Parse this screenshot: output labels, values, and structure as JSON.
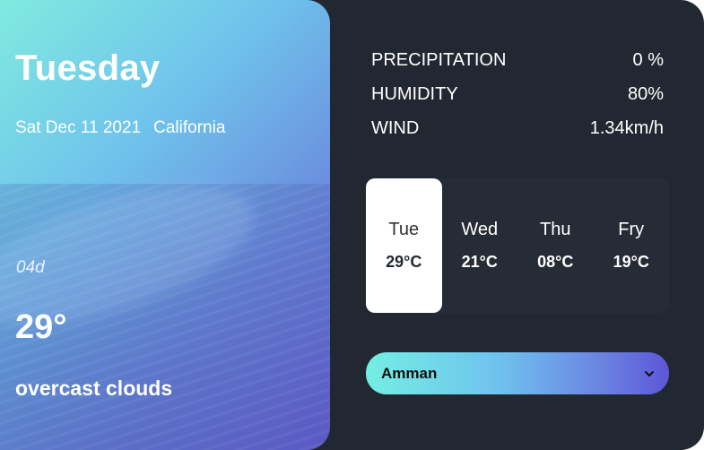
{
  "current": {
    "day": "Tuesday",
    "date": "Sat Dec 11 2021",
    "location": "California",
    "icon_code": "04d",
    "temperature": "29°",
    "description": "overcast clouds"
  },
  "stats": [
    {
      "label": "PRECIPITATION",
      "value": "0 %"
    },
    {
      "label": "HUMIDITY",
      "value": "80%"
    },
    {
      "label": "WIND",
      "value": "1.34km/h"
    }
  ],
  "forecast": [
    {
      "day": "Tue",
      "temp": "29°C",
      "active": true
    },
    {
      "day": "Wed",
      "temp": "21°C",
      "active": false
    },
    {
      "day": "Thu",
      "temp": "08°C",
      "active": false
    },
    {
      "day": "Fry",
      "temp": "19°C",
      "active": false
    }
  ],
  "city_select": {
    "selected": "Amman",
    "icon": "chevron-down-icon"
  },
  "colors": {
    "background": "#222831",
    "panel": "#262c36",
    "gradient_start": "#74eee3",
    "gradient_end": "#5c56d8"
  }
}
